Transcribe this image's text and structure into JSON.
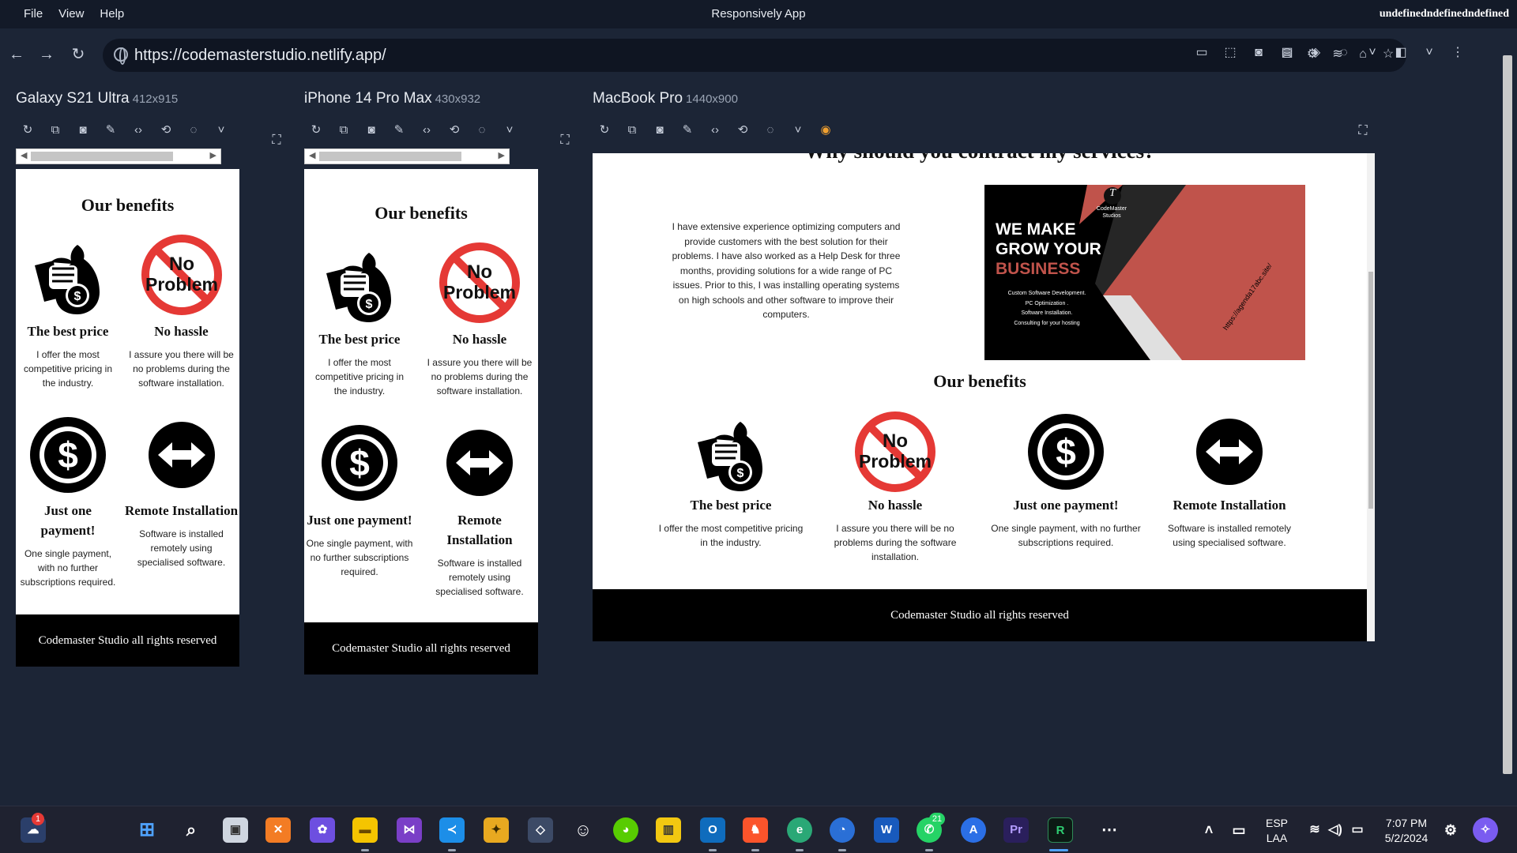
{
  "menu": [
    "File",
    "View",
    "Help"
  ],
  "app_title": "Responsively App",
  "user_name": "undefinedndefinedndefined",
  "url": "https://codemasterstudio.netlify.app/",
  "devices": [
    {
      "name": "Galaxy S21 Ultra",
      "dims": "412x915"
    },
    {
      "name": "iPhone 14 Pro Max",
      "dims": "430x932"
    },
    {
      "name": "MacBook Pro",
      "dims": "1440x900"
    }
  ],
  "site": {
    "section_heading_partial": "Why should you contract my services?",
    "about_text": "I have extensive experience optimizing computers and provide customers with the best solution for their problems. I have also worked as a Help Desk for three months, providing solutions for a wide range of PC issues. Prior to this, I was installing operating systems on high schools and other software to improve their computers.",
    "banner": {
      "logo_letter": "T",
      "brand": "CodeMaster Studios",
      "line1": "WE MAKE",
      "line2": "GROW YOUR",
      "line3": "BUSINESS",
      "services": [
        "Custom Software Development.",
        "PC Optimization .",
        "Software Installation.",
        "Consulting for your hosting"
      ],
      "link": "https://agenda17abc.site/"
    },
    "benefits_title": "Our benefits",
    "benefits": [
      {
        "title": "The best price",
        "desc": "I offer the most competitive pricing in the industry."
      },
      {
        "title": "No hassle",
        "desc": "I assure you there will be no problems during the software installation."
      },
      {
        "title": "Just one payment!",
        "desc": "One single payment, with no further subscriptions required."
      },
      {
        "title": "Remote Installation",
        "desc": "Software is installed remotely using specialised software."
      }
    ],
    "no_problem_line1": "No",
    "no_problem_line2": "Problem",
    "footer": "Codemaster Studio all rights reserved"
  },
  "tray": {
    "language": "ESP",
    "layout": "LAA",
    "time": "7:07 PM",
    "date": "5/2/2024",
    "notification_count": "1",
    "whatsapp_badge": "21"
  },
  "colors": {
    "accent_red": "#e53935",
    "banner_red": "#c0534b"
  }
}
